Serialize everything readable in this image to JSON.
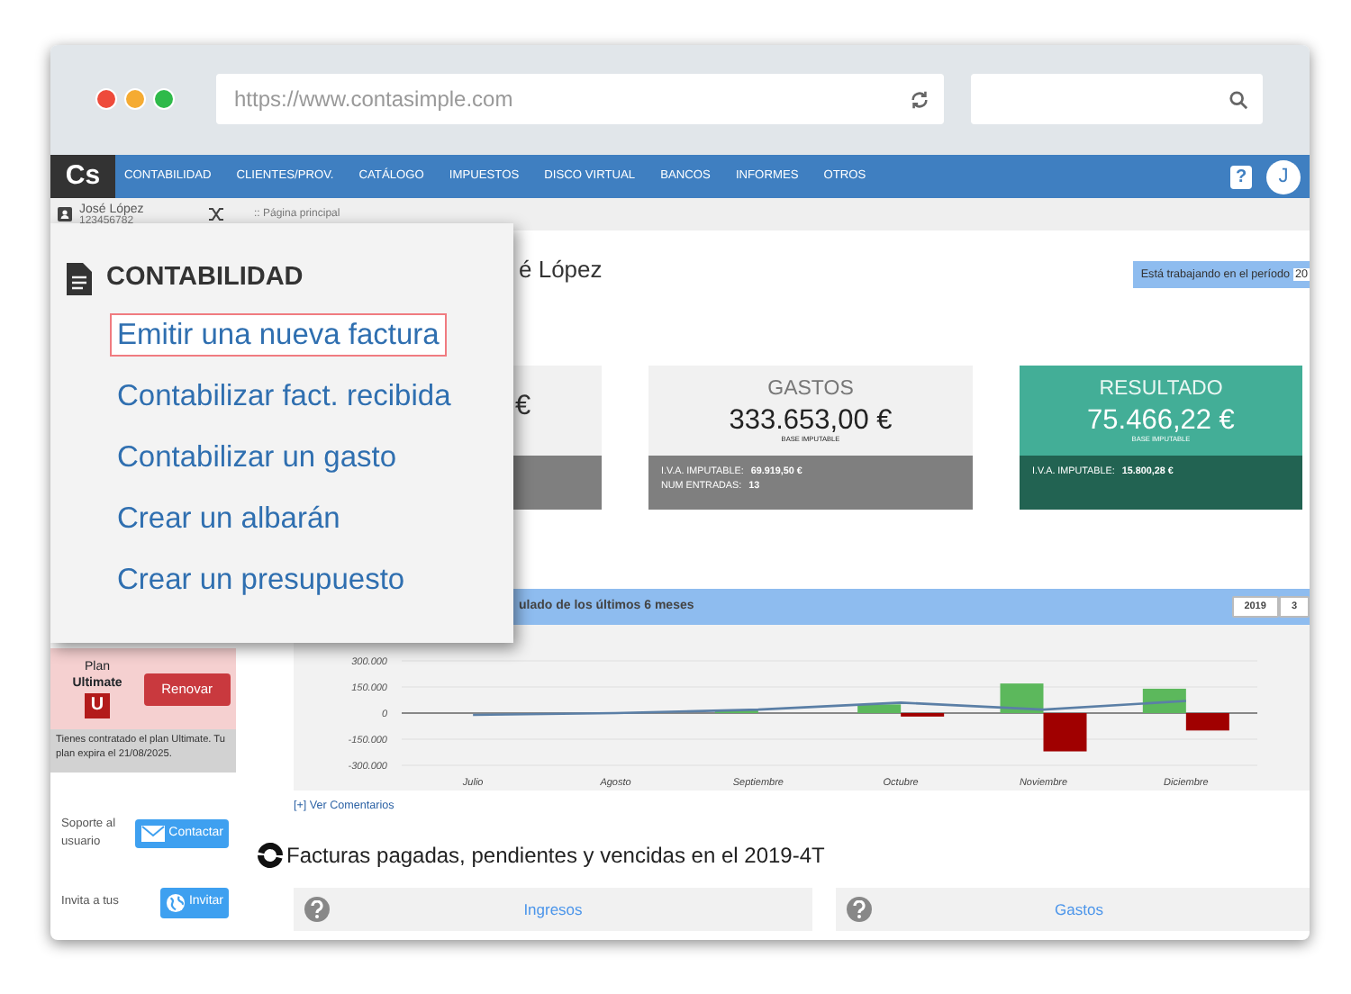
{
  "browser": {
    "url": "https://www.contasimple.com"
  },
  "navbar": {
    "logo": "Cs",
    "items": [
      {
        "label": "CONTABILIDAD",
        "selected": false
      },
      {
        "label": "CLIENTES/PROV.",
        "selected": false
      },
      {
        "label": "CATÁLOGO",
        "selected": false
      },
      {
        "label": "IMPUESTOS",
        "selected": false
      },
      {
        "label": "DISCO VIRTUAL",
        "selected": false
      },
      {
        "label": "BANCOS",
        "selected": false
      },
      {
        "label": "INFORMES",
        "selected": false
      },
      {
        "label": "OTROS",
        "selected": false
      }
    ],
    "help": "?",
    "avatar": "J"
  },
  "user": {
    "name": "José López",
    "id": "123456782"
  },
  "breadcrumb": ":: Página principal",
  "menu": {
    "title": "CONTABILIDAD",
    "items": [
      {
        "label": "Emitir una nueva factura",
        "selected": true
      },
      {
        "label": "Contabilizar fact. recibida",
        "selected": false
      },
      {
        "label": "Contabilizar un gasto",
        "selected": false
      },
      {
        "label": "Crear un albarán",
        "selected": false
      },
      {
        "label": "Crear un presupuesto",
        "selected": false
      }
    ]
  },
  "heading": "é López",
  "period": {
    "label": "Está trabajando en el período",
    "value": "20"
  },
  "cards": [
    {
      "kind": "partial",
      "amount": "€"
    },
    {
      "kind": "neutral",
      "title": "GASTOS",
      "amount": "333.653,00 €",
      "caption": "BASE IMPUTABLE",
      "details": [
        {
          "label": "I.V.A. IMPUTABLE:",
          "value": "69.919,50 €"
        },
        {
          "label": "NUM ENTRADAS:",
          "value": "13"
        }
      ]
    },
    {
      "kind": "positive",
      "title": "RESULTADO",
      "amount": "75.466,22 €",
      "caption": "BASE IMPUTABLE",
      "details": [
        {
          "label": "I.V.A. IMPUTABLE:",
          "value": "15.800,28 €"
        }
      ]
    }
  ],
  "chart_panel": {
    "title": "ulado de los últimos 6 meses",
    "buttons": [
      "2019",
      "3"
    ],
    "comments_link": "[+] Ver Comentarios",
    "chart_data": {
      "type": "bar",
      "categories": [
        "Julio",
        "Agosto",
        "Septiembre",
        "Octubre",
        "Noviembre",
        "Diciembre"
      ],
      "series": [
        {
          "color": "#5cb85c",
          "values": [
            0,
            0,
            20000,
            50000,
            170000,
            140000
          ]
        },
        {
          "color": "#a00000",
          "values": [
            0,
            0,
            0,
            -20000,
            -220000,
            -100000
          ]
        },
        {
          "color": "#5b7fa6",
          "type": "line",
          "values": [
            -10000,
            0,
            20000,
            60000,
            20000,
            70000
          ]
        }
      ],
      "ylim": [
        -300000,
        300000
      ],
      "yticks": [
        {
          "value": 300000,
          "label": "300.000"
        },
        {
          "value": 150000,
          "label": "150.000"
        },
        {
          "value": 0,
          "label": "0"
        },
        {
          "value": -150000,
          "label": "-150.000"
        },
        {
          "value": -300000,
          "label": "-300.000"
        }
      ]
    }
  },
  "plan": {
    "label": "Plan",
    "name": "Ultimate",
    "badge": "U",
    "button": "Renovar",
    "note": "Tienes contratado el plan Ultimate. Tu plan expira el 21/08/2025."
  },
  "support": [
    {
      "kind": "mail",
      "text": "Soporte al usuario",
      "button": "Contactar"
    },
    {
      "kind": "globe",
      "text": "Invita a tus",
      "button": "Invitar"
    }
  ],
  "invoices": {
    "title": "Facturas pagadas, pendientes y vencidas en el 2019-4T",
    "panels": [
      "Ingresos",
      "Gastos"
    ]
  }
}
